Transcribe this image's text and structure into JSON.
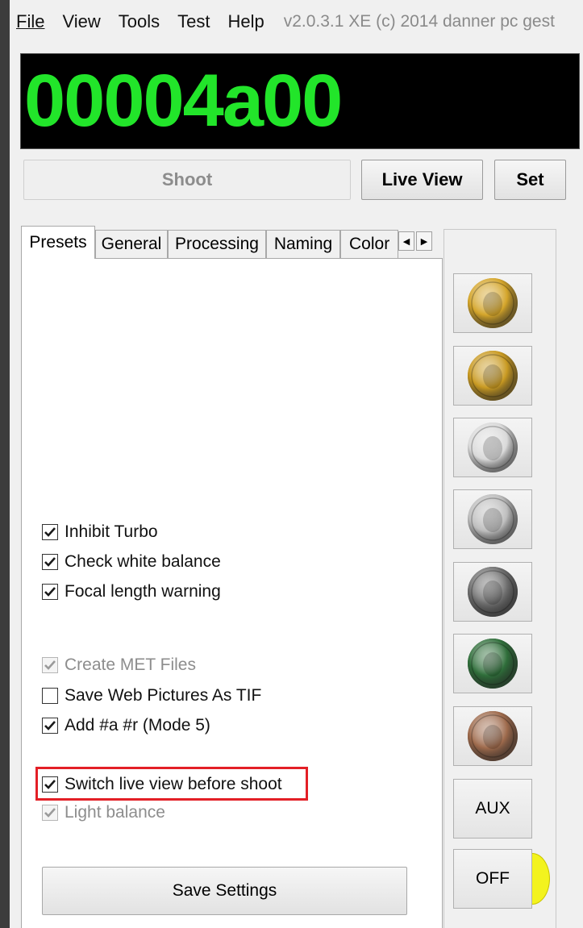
{
  "menu": {
    "file": "File",
    "view": "View",
    "tools": "Tools",
    "test": "Test",
    "help": "Help",
    "version": "v2.0.3.1 XE (c) 2014 danner pc gest"
  },
  "display": {
    "counter": "00004a00",
    "color": "#22e52a"
  },
  "buttons": {
    "shoot": "Shoot",
    "live_view": "Live View",
    "set": "Set",
    "save_settings": "Save Settings"
  },
  "tabs": [
    "Presets",
    "General",
    "Processing",
    "Naming",
    "Color"
  ],
  "active_tab": "Presets",
  "checkboxes": [
    {
      "label": "Inhibit Turbo",
      "checked": true,
      "enabled": true
    },
    {
      "label": "Check white balance",
      "checked": true,
      "enabled": true
    },
    {
      "label": "Focal length warning",
      "checked": true,
      "enabled": true
    },
    {
      "label": "Create MET Files",
      "checked": true,
      "enabled": false
    },
    {
      "label": "Save Web Pictures As TIF",
      "checked": false,
      "enabled": true
    },
    {
      "label": "Add #a #r (Mode 5)",
      "checked": true,
      "enabled": true
    },
    {
      "label": "Switch live view before shoot",
      "checked": true,
      "enabled": true,
      "highlighted": true
    },
    {
      "label": "Light balance",
      "checked": true,
      "enabled": false
    }
  ],
  "presets": {
    "coins": [
      {
        "icon": "gold-coin-gate-icon",
        "color": "#d4a52a"
      },
      {
        "icon": "gold-coin-figure-icon",
        "color": "#c99a22"
      },
      {
        "icon": "silver-coin-eagle-icon",
        "color": "#d9d9d9"
      },
      {
        "icon": "silver-coin-portrait-icon",
        "color": "#bdbdbd"
      },
      {
        "icon": "dark-coin-portrait-icon",
        "color": "#6e6e6e"
      },
      {
        "icon": "green-coin-portrait-icon",
        "color": "#2f6e3a"
      },
      {
        "icon": "copper-coin-crest-icon",
        "color": "#9e6a4c"
      }
    ],
    "aux": "AUX",
    "off": "OFF",
    "indicator_color": "#f3f31e"
  },
  "highlight_color": "#e31f26"
}
